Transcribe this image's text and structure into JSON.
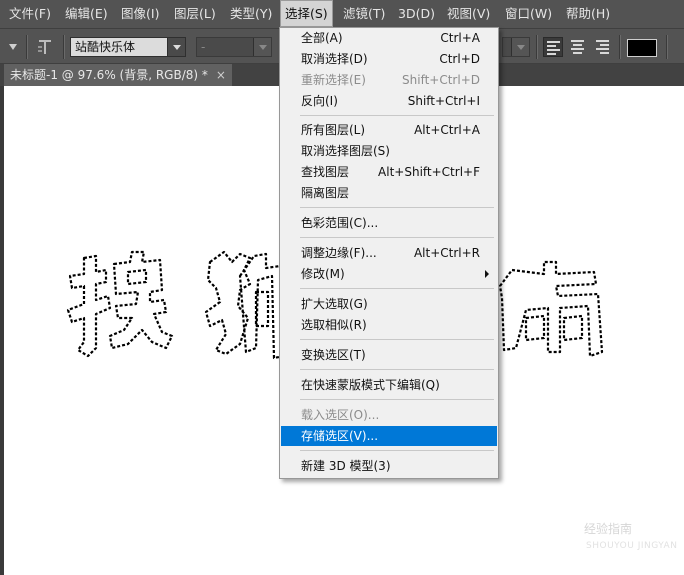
{
  "menubar": {
    "items": [
      {
        "label": "文件(F)"
      },
      {
        "label": "编辑(E)"
      },
      {
        "label": "图像(I)"
      },
      {
        "label": "图层(L)"
      },
      {
        "label": "类型(Y)"
      },
      {
        "label": "选择(S)"
      },
      {
        "label": "滤镜(T)"
      },
      {
        "label": "3D(D)"
      },
      {
        "label": "视图(V)"
      },
      {
        "label": "窗口(W)"
      },
      {
        "label": "帮助(H)"
      }
    ]
  },
  "options": {
    "font_family": "站酷快乐体",
    "font_style": "-"
  },
  "document_tab": {
    "title": "未标题-1 @ 97.6% (背景, RGB/8) *",
    "close": "×"
  },
  "select_menu": {
    "items": [
      {
        "label": "全部(A)",
        "shortcut": "Ctrl+A",
        "state": "normal"
      },
      {
        "label": "取消选择(D)",
        "shortcut": "Ctrl+D",
        "state": "normal"
      },
      {
        "label": "重新选择(E)",
        "shortcut": "Shift+Ctrl+D",
        "state": "disabled"
      },
      {
        "label": "反向(I)",
        "shortcut": "Shift+Ctrl+I",
        "state": "normal"
      },
      {
        "label": "所有图层(L)",
        "shortcut": "Alt+Ctrl+A",
        "state": "normal"
      },
      {
        "label": "取消选择图层(S)",
        "shortcut": "",
        "state": "normal"
      },
      {
        "label": "查找图层",
        "shortcut": "Alt+Shift+Ctrl+F",
        "state": "normal"
      },
      {
        "label": "隔离图层",
        "shortcut": "",
        "state": "normal"
      },
      {
        "label": "色彩范围(C)...",
        "shortcut": "",
        "state": "normal"
      },
      {
        "label": "调整边缘(F)...",
        "shortcut": "Alt+Ctrl+R",
        "state": "normal"
      },
      {
        "label": "修改(M)",
        "shortcut": "",
        "state": "submenu"
      },
      {
        "label": "扩大选取(G)",
        "shortcut": "",
        "state": "normal"
      },
      {
        "label": "选取相似(R)",
        "shortcut": "",
        "state": "normal"
      },
      {
        "label": "变换选区(T)",
        "shortcut": "",
        "state": "normal"
      },
      {
        "label": "在快速蒙版模式下编辑(Q)",
        "shortcut": "",
        "state": "normal"
      },
      {
        "label": "载入选区(O)...",
        "shortcut": "",
        "state": "disabled"
      },
      {
        "label": "存储选区(V)...",
        "shortcut": "",
        "state": "highlighted"
      },
      {
        "label": "新建 3D 模型(3)",
        "shortcut": "",
        "state": "normal"
      }
    ]
  },
  "canvas": {
    "visible_glyphs": [
      "搜",
      "狗",
      "南"
    ],
    "watermark": "经验指南",
    "watermark_sub": "SHOUYOU JINGYAN"
  },
  "colors": {
    "ui_dark": "#535353",
    "menu_bg": "#f0f0f0",
    "highlight": "#0078d7",
    "text_color_swatch": "#000000"
  }
}
